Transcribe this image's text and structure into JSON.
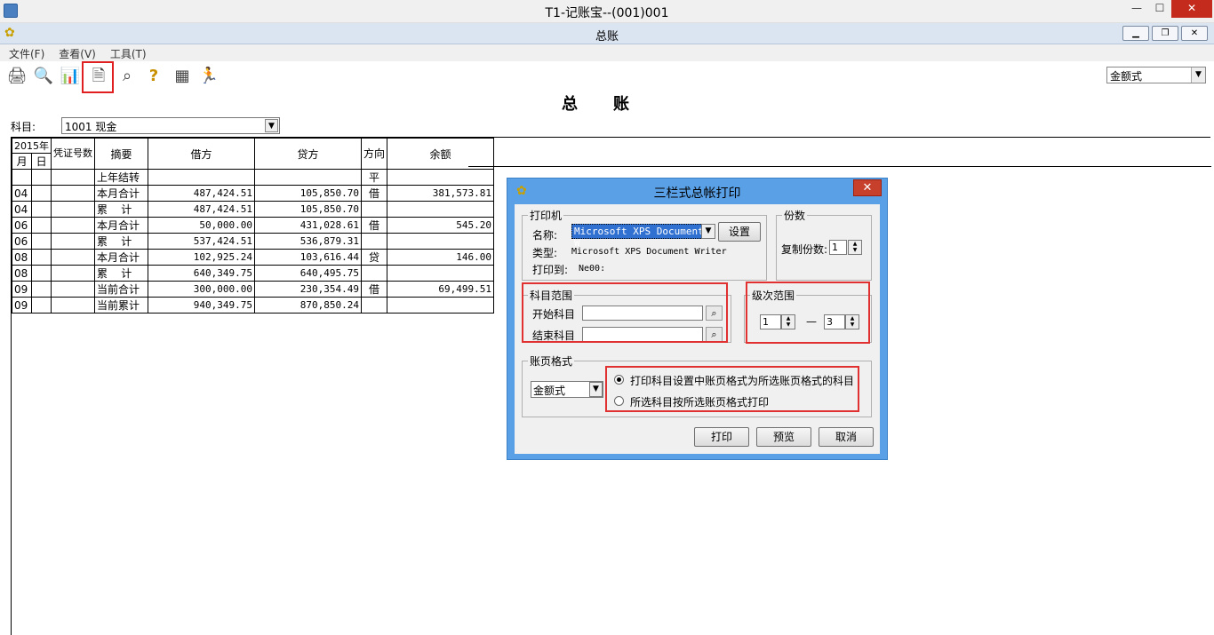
{
  "window": {
    "title": "T1-记账宝--(001)001",
    "sub_title": "总账"
  },
  "menu": [
    {
      "label": "文件(F)"
    },
    {
      "label": "查看(V)"
    },
    {
      "label": "工具(T)"
    }
  ],
  "toolbar": {
    "icons": [
      "print-icon",
      "preview-icon",
      "export-icon",
      "print-ledger-icon",
      "search-icon",
      "help-icon",
      "calculator-icon",
      "exit-icon"
    ],
    "format_select": "金额式"
  },
  "ledger": {
    "title": "总账",
    "subject_label": "科目:",
    "subject_value": "1001  现金",
    "header": {
      "year": "2015年",
      "month": "月",
      "day": "日",
      "voucher": "凭证号数",
      "summary": "摘要",
      "debit": "借方",
      "credit": "贷方",
      "direction": "方向",
      "balance": "余额"
    },
    "rows": [
      {
        "month": "",
        "day": "",
        "voucher": "",
        "summary": "上年结转",
        "debit": "",
        "credit": "",
        "dir": "平",
        "balance": ""
      },
      {
        "month": "04",
        "day": "",
        "voucher": "",
        "summary": "本月合计",
        "debit": "487,424.51",
        "credit": "105,850.70",
        "dir": "借",
        "balance": "381,573.81"
      },
      {
        "month": "04",
        "day": "",
        "voucher": "",
        "summary": "累    计",
        "debit": "487,424.51",
        "credit": "105,850.70",
        "dir": "",
        "balance": ""
      },
      {
        "month": "06",
        "day": "",
        "voucher": "",
        "summary": "本月合计",
        "debit": "50,000.00",
        "credit": "431,028.61",
        "dir": "借",
        "balance": "545.20"
      },
      {
        "month": "06",
        "day": "",
        "voucher": "",
        "summary": "累    计",
        "debit": "537,424.51",
        "credit": "536,879.31",
        "dir": "",
        "balance": ""
      },
      {
        "month": "08",
        "day": "",
        "voucher": "",
        "summary": "本月合计",
        "debit": "102,925.24",
        "credit": "103,616.44",
        "dir": "贷",
        "balance": "146.00"
      },
      {
        "month": "08",
        "day": "",
        "voucher": "",
        "summary": "累    计",
        "debit": "640,349.75",
        "credit": "640,495.75",
        "dir": "",
        "balance": ""
      },
      {
        "month": "09",
        "day": "",
        "voucher": "",
        "summary": "当前合计",
        "debit": "300,000.00",
        "credit": "230,354.49",
        "dir": "借",
        "balance": "69,499.51"
      },
      {
        "month": "09",
        "day": "",
        "voucher": "",
        "summary": "当前累计",
        "debit": "940,349.75",
        "credit": "870,850.24",
        "dir": "",
        "balance": ""
      }
    ]
  },
  "dialog": {
    "title": "三栏式总帐打印",
    "printer_group": "打印机",
    "name_label": "名称:",
    "name_value": "Microsoft XPS Document W",
    "setup_button": "设置",
    "type_label": "类型:",
    "type_value": "Microsoft XPS Document Writer",
    "printto_label": "打印到:",
    "printto_value": "Ne00:",
    "copies_group": "份数",
    "copies_label": "复制份数:",
    "copies_value": "1",
    "subject_range_group": "科目范围",
    "start_subject_label": "开始科目",
    "end_subject_label": "结束科目",
    "level_range_group": "级次范围",
    "level_from": "1",
    "level_dash": "—",
    "level_to": "3",
    "page_format_group": "账页格式",
    "page_format_value": "金额式",
    "radio1": "打印科目设置中账页格式为所选账页格式的科目",
    "radio2": "所选科目按所选账页格式打印",
    "print_button": "打印",
    "preview_button": "预览",
    "cancel_button": "取消"
  }
}
